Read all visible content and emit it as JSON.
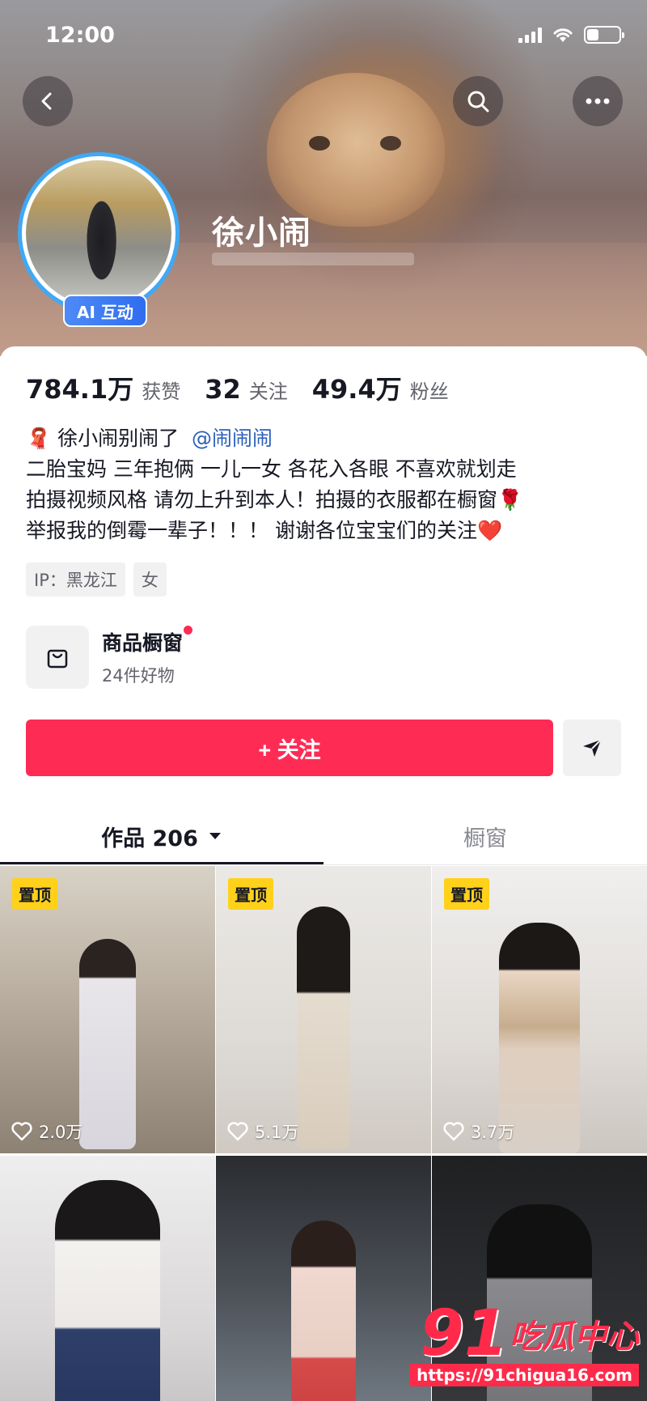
{
  "status_bar": {
    "time": "12:00"
  },
  "profile": {
    "username": "徐小闹",
    "ai_badge": "AI 互动"
  },
  "stats": [
    {
      "value": "784.1万",
      "label": "获赞"
    },
    {
      "value": "32",
      "label": "关注"
    },
    {
      "value": "49.4万",
      "label": "粉丝"
    }
  ],
  "bio": {
    "line1_prefix": "🧣",
    "line1_text": "徐小闹别闹了",
    "line1_mention": "@闹闹闹",
    "line2": "二胎宝妈 三年抱俩 一儿一女 各花入各眼 不喜欢就划走",
    "line3": "拍摄视频风格 请勿上升到本人！拍摄的衣服都在橱窗",
    "line3_emoji": "🌹",
    "line4": "举报我的倒霉一辈子！！！ 谢谢各位宝宝们的关注",
    "line4_emoji": "❤️"
  },
  "tags": [
    "IP：黑龙江",
    "女"
  ],
  "shop": {
    "title": "商品橱窗",
    "subtitle": "24件好物"
  },
  "actions": {
    "follow_label": "+ 关注"
  },
  "tabs": {
    "works": "作品 206",
    "showcase": "橱窗"
  },
  "videos": [
    {
      "pinned_label": "置顶",
      "likes": "2.0万"
    },
    {
      "pinned_label": "置顶",
      "likes": "5.1万"
    },
    {
      "pinned_label": "置顶",
      "likes": "3.7万"
    },
    {
      "pinned_label": "",
      "likes": ""
    },
    {
      "pinned_label": "",
      "likes": ""
    },
    {
      "pinned_label": "",
      "likes": ""
    }
  ],
  "watermark": {
    "logo_number": "91",
    "logo_text": "吃瓜中心",
    "url": "https://91chigua16.com"
  },
  "colors": {
    "accent": "#fe2c55",
    "mention": "#2a5fb8",
    "pin": "#ffd11b",
    "ai_badge": "#2f6df0"
  }
}
